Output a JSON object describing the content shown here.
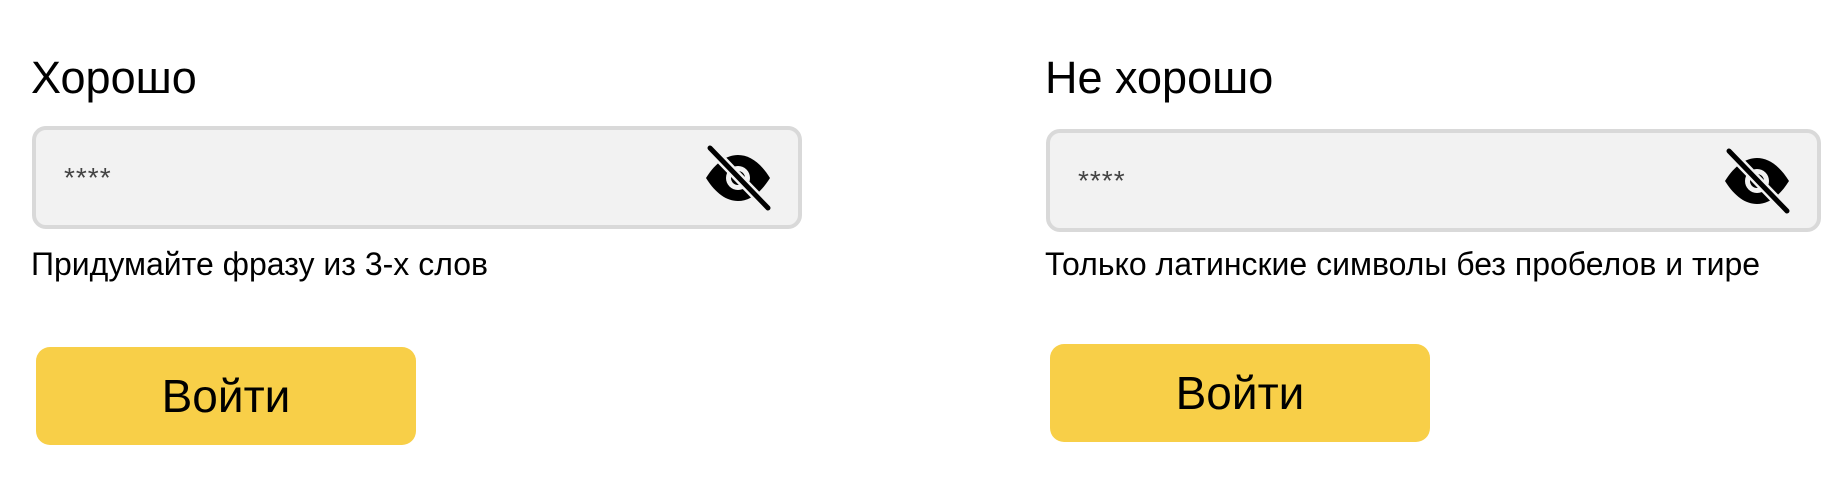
{
  "good": {
    "title": "Хорошо",
    "password_value": "****",
    "hint": "Придумайте фразу из 3-х слов",
    "login_label": "Войти",
    "visibility_icon": "eye-slash-icon"
  },
  "bad": {
    "title": "Не хорошо",
    "password_value": "****",
    "hint": "Только латинские символы без пробелов и тире",
    "login_label": "Войти",
    "visibility_icon": "eye-slash-icon"
  },
  "colors": {
    "button": "#f8cf48",
    "field_background": "#f2f2f2",
    "field_border": "#d9d9d9"
  }
}
